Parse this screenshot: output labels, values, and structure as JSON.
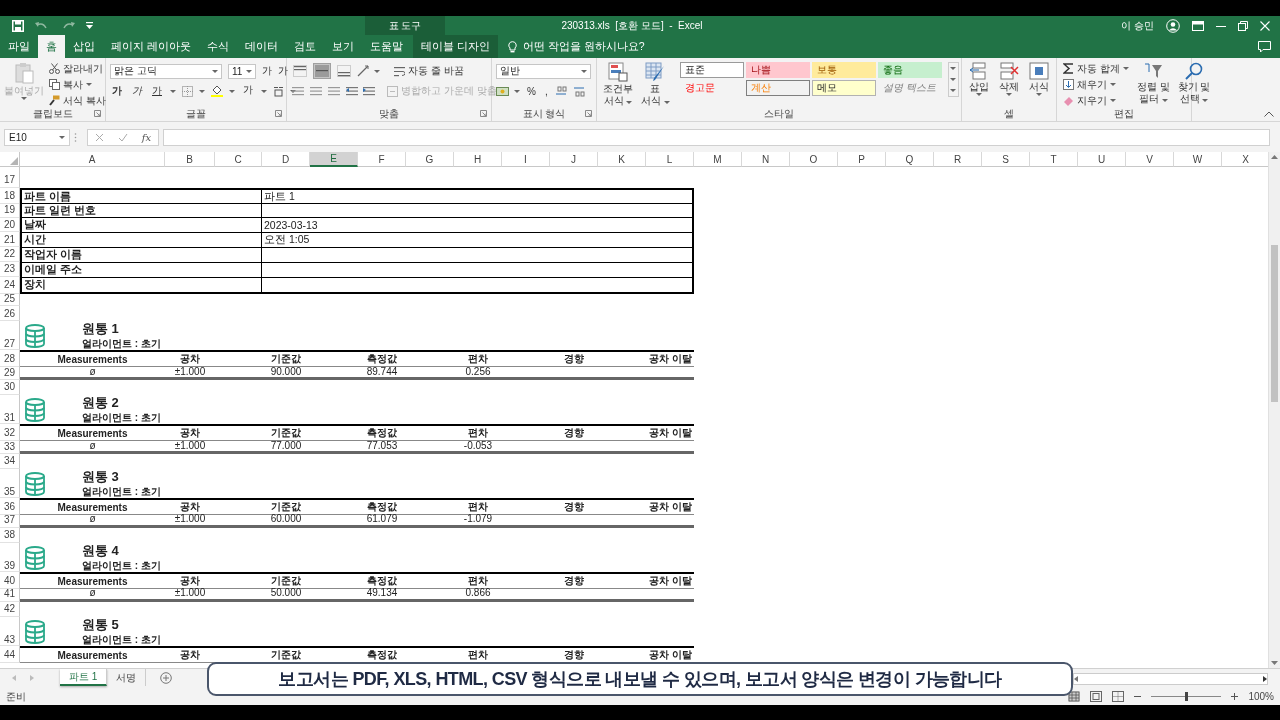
{
  "title_bar": {
    "context_label": "표 도구",
    "title": "230313.xls  [호환 모드]  -  Excel",
    "user": "이 승민"
  },
  "tabs": [
    {
      "label": "파일",
      "selected": false,
      "kind": "normal"
    },
    {
      "label": "홈",
      "selected": true,
      "kind": "normal"
    },
    {
      "label": "삽입",
      "selected": false,
      "kind": "normal"
    },
    {
      "label": "페이지 레이아웃",
      "selected": false,
      "kind": "normal"
    },
    {
      "label": "수식",
      "selected": false,
      "kind": "normal"
    },
    {
      "label": "데이터",
      "selected": false,
      "kind": "normal"
    },
    {
      "label": "검토",
      "selected": false,
      "kind": "normal"
    },
    {
      "label": "보기",
      "selected": false,
      "kind": "normal"
    },
    {
      "label": "도움말",
      "selected": false,
      "kind": "normal"
    },
    {
      "label": "테이블 디자인",
      "selected": false,
      "kind": "contextual"
    }
  ],
  "tell_me": "어떤 작업을 원하시나요?",
  "ribbon": {
    "clipboard": {
      "label": "클립보드",
      "paste": {
        "label": "붙여넣기",
        "disabled": true
      },
      "cut": "잘라내기",
      "copy": "복사",
      "format_painter": "서식 복사"
    },
    "font": {
      "label": "글꼴",
      "name": "맑은 고딕",
      "size": "11",
      "grow": "가",
      "shrink": "가",
      "bold": "가",
      "italic": "가",
      "underline": "가",
      "color_letter": "가"
    },
    "alignment": {
      "label": "맞춤",
      "vertical_align": [
        {
          "selected": false
        },
        {
          "selected": true
        },
        {
          "selected": false
        }
      ],
      "wrap": "자동 줄 바꿈",
      "merge": {
        "label": "병합하고 가운데 맞춤",
        "disabled": true
      }
    },
    "number": {
      "label": "표시 형식",
      "format": "일반",
      "percent": "%",
      "comma": ","
    },
    "styles": {
      "label": "스타일",
      "conditional_formatting": [
        "조건부",
        "서식"
      ],
      "format_as_table": [
        "표",
        "서식"
      ],
      "cell_styles": [
        {
          "label": "표준",
          "kind": "normal"
        },
        {
          "label": "나쁨",
          "kind": "bad"
        },
        {
          "label": "보통",
          "kind": "neutral"
        },
        {
          "label": "좋음",
          "kind": "good"
        },
        {
          "label": "경고문",
          "kind": "warning"
        },
        {
          "label": "계산",
          "kind": "calculation"
        },
        {
          "label": "메모",
          "kind": "note"
        },
        {
          "label": "설명 텍스트",
          "kind": "explanatory"
        }
      ]
    },
    "cells": {
      "label": "셀",
      "insert": "삽입",
      "delete": "삭제",
      "format": "서식"
    },
    "editing": {
      "label": "편집",
      "autosum": "자동 합계",
      "fill": "채우기",
      "clear": "지우기",
      "sort": [
        "정렬 및",
        "필터"
      ],
      "find": [
        "찾기 및",
        "선택"
      ]
    }
  },
  "formula_bar": {
    "name_box": "E10",
    "function_label": "fx"
  },
  "sheet": {
    "columns": [
      {
        "label": "A",
        "selected": false
      },
      {
        "label": "B",
        "selected": false
      },
      {
        "label": "C",
        "selected": false
      },
      {
        "label": "D",
        "selected": false
      },
      {
        "label": "E",
        "selected": true
      },
      {
        "label": "F",
        "selected": false
      },
      {
        "label": "G",
        "selected": false
      },
      {
        "label": "H",
        "selected": false
      },
      {
        "label": "I",
        "selected": false
      },
      {
        "label": "J",
        "selected": false
      },
      {
        "label": "K",
        "selected": false
      },
      {
        "label": "L",
        "selected": false
      },
      {
        "label": "M",
        "selected": false
      },
      {
        "label": "N",
        "selected": false
      },
      {
        "label": "O",
        "selected": false
      },
      {
        "label": "P",
        "selected": false
      },
      {
        "label": "Q",
        "selected": false
      },
      {
        "label": "R",
        "selected": false
      },
      {
        "label": "S",
        "selected": false
      },
      {
        "label": "T",
        "selected": false
      },
      {
        "label": "U",
        "selected": false
      },
      {
        "label": "V",
        "selected": false
      },
      {
        "label": "W",
        "selected": false
      },
      {
        "label": "X",
        "selected": false
      }
    ],
    "rows": [
      {
        "number": "17",
        "kind": "blank"
      },
      {
        "number": "18",
        "kind": "info",
        "label": "파트 이름",
        "value": "파트 1"
      },
      {
        "number": "19",
        "kind": "info",
        "label": "파트 일련 번호"
      },
      {
        "number": "20",
        "kind": "info",
        "label": "날짜",
        "value": "2023-03-13"
      },
      {
        "number": "21",
        "kind": "info",
        "label": "시간",
        "value": "오전 1:05"
      },
      {
        "number": "22",
        "kind": "info",
        "label": "작업자 이름"
      },
      {
        "number": "23",
        "kind": "info",
        "label": "이메일 주소"
      },
      {
        "number": "24",
        "kind": "info",
        "label": "장치"
      },
      {
        "number": "25",
        "kind": "blank"
      },
      {
        "number": "26",
        "kind": "blank"
      },
      {
        "number": "27",
        "kind": "title",
        "title": "원통 1",
        "subtitle": "얼라이먼트 : 초기"
      },
      {
        "number": "28",
        "kind": "header",
        "cells": [
          "Measurements",
          "공차",
          "기준값",
          "측정값",
          "편차",
          "경향",
          "공차 이탈"
        ]
      },
      {
        "number": "29",
        "kind": "values",
        "cells": [
          "ø",
          "±1.000",
          "90.000",
          "89.744",
          "0.256"
        ]
      },
      {
        "number": "30",
        "kind": "blank"
      },
      {
        "number": "31",
        "kind": "title",
        "title": "원통 2",
        "subtitle": "얼라이먼트 : 초기"
      },
      {
        "number": "32",
        "kind": "header",
        "cells": [
          "Measurements",
          "공차",
          "기준값",
          "측정값",
          "편차",
          "경향",
          "공차 이탈"
        ]
      },
      {
        "number": "33",
        "kind": "values",
        "cells": [
          "ø",
          "±1.000",
          "77.000",
          "77.053",
          "-0.053"
        ]
      },
      {
        "number": "34",
        "kind": "blank"
      },
      {
        "number": "35",
        "kind": "title",
        "title": "원통 3",
        "subtitle": "얼라이먼트 : 초기"
      },
      {
        "number": "36",
        "kind": "header",
        "cells": [
          "Measurements",
          "공차",
          "기준값",
          "측정값",
          "편차",
          "경향",
          "공차 이탈"
        ]
      },
      {
        "number": "37",
        "kind": "values",
        "cells": [
          "ø",
          "±1.000",
          "60.000",
          "61.079",
          "-1.079"
        ]
      },
      {
        "number": "38",
        "kind": "blank"
      },
      {
        "number": "39",
        "kind": "title",
        "title": "원통 4",
        "subtitle": "얼라이먼트 : 초기"
      },
      {
        "number": "40",
        "kind": "header",
        "cells": [
          "Measurements",
          "공차",
          "기준값",
          "측정값",
          "편차",
          "경향",
          "공차 이탈"
        ]
      },
      {
        "number": "41",
        "kind": "values",
        "cells": [
          "ø",
          "±1.000",
          "50.000",
          "49.134",
          "0.866"
        ]
      },
      {
        "number": "42",
        "kind": "blank"
      },
      {
        "number": "43",
        "kind": "title",
        "title": "원통 5",
        "subtitle": "얼라이먼트 : 초기"
      },
      {
        "number": "44",
        "kind": "header",
        "cells": [
          "Measurements",
          "공차",
          "기준값",
          "측정값",
          "편차",
          "경향",
          "공차 이탈"
        ]
      }
    ]
  },
  "sheet_tabs": [
    {
      "label": "파트 1",
      "selected": true
    },
    {
      "label": "서명",
      "selected": false
    }
  ],
  "status_bar": {
    "status": "준비",
    "zoom": "100%",
    "zoom_slider": {
      "level": 0.5
    }
  },
  "caption": "보고서는 PDF, XLS, HTML, CSV 형식으로 내보낼 수 있으며, 보고서 양식은 변경이 가능합니다"
}
